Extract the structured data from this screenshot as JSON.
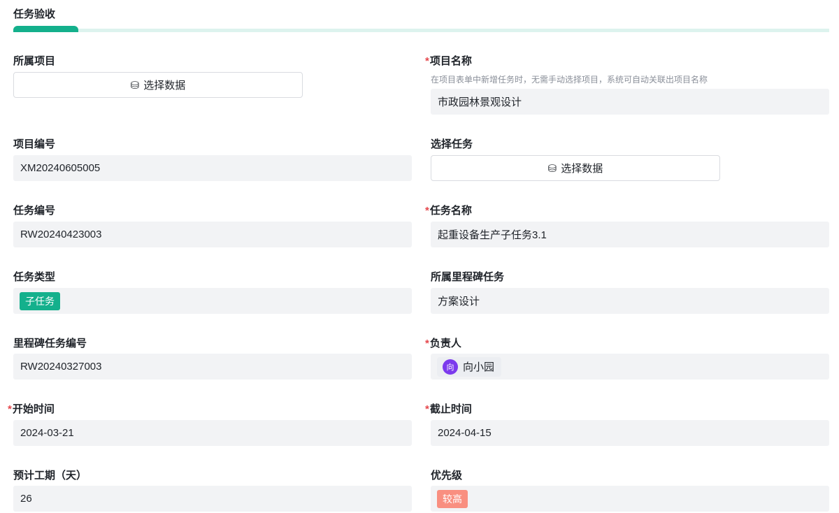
{
  "section_title": "任务验收",
  "progress_percent": 8,
  "select_data_label": "选择数据",
  "fields": {
    "project": {
      "label": "所属项目"
    },
    "project_name": {
      "label": "项目名称",
      "hint": "在项目表单中新增任务时，无需手动选择项目，系统可自动关联出项目名称",
      "value": "市政园林景观设计"
    },
    "project_no": {
      "label": "项目编号",
      "value": "XM20240605005"
    },
    "select_task": {
      "label": "选择任务"
    },
    "task_no": {
      "label": "任务编号",
      "value": "RW20240423003"
    },
    "task_name": {
      "label": "任务名称",
      "value": "起重设备生产子任务3.1"
    },
    "task_type": {
      "label": "任务类型",
      "value": "子任务",
      "color": "#14b08c"
    },
    "milestone": {
      "label": "所属里程碑任务",
      "value": "方案设计"
    },
    "milestone_no": {
      "label": "里程碑任务编号",
      "value": "RW20240327003"
    },
    "owner": {
      "label": "负责人",
      "value": "向小园",
      "avatar": "向"
    },
    "start": {
      "label": "开始时间",
      "value": "2024-03-21"
    },
    "end": {
      "label": "截止时间",
      "value": "2024-04-15"
    },
    "duration": {
      "label": "预计工期（天）",
      "value": "26"
    },
    "priority": {
      "label": "优先级",
      "value": "较高",
      "color": "#f98f80"
    }
  },
  "required_mark": "*"
}
